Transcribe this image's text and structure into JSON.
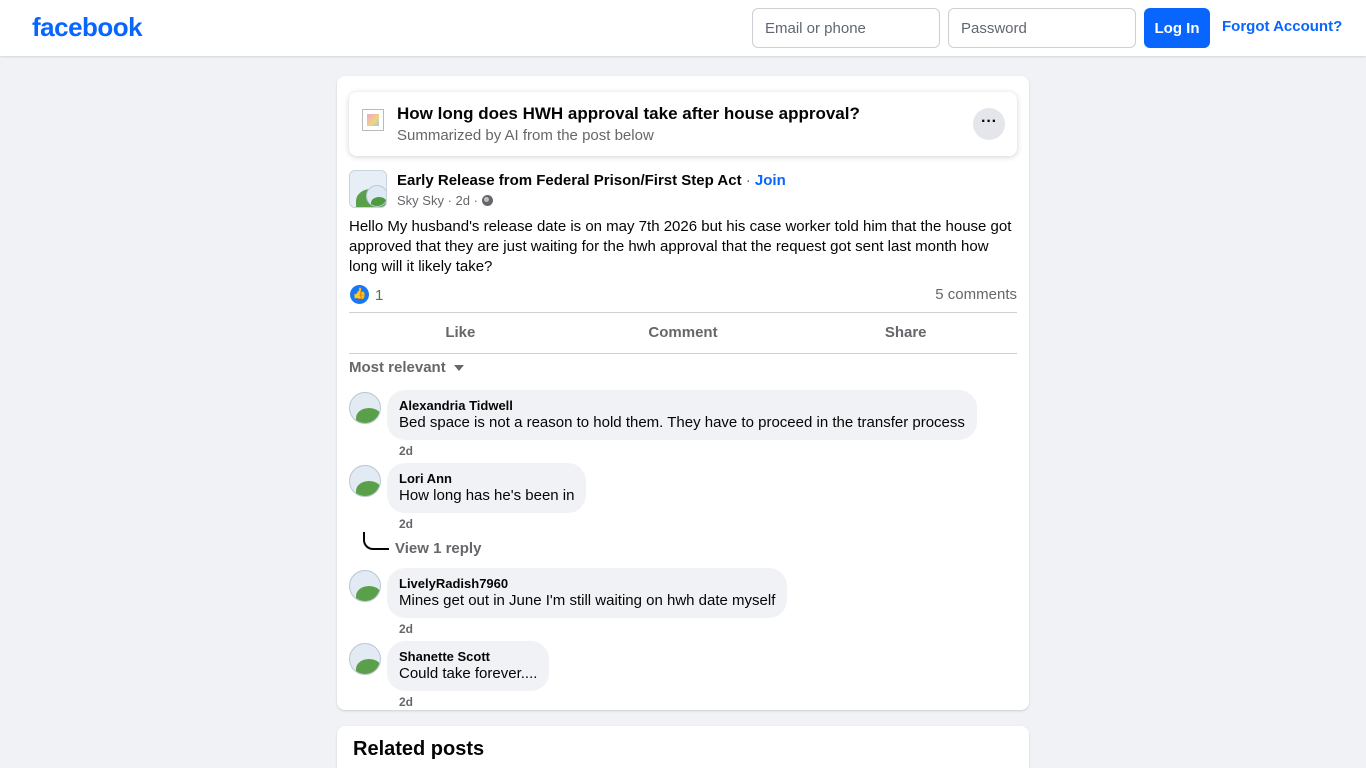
{
  "header": {
    "logo": "facebook",
    "email_placeholder": "Email or phone",
    "password_placeholder": "Password",
    "login_label": "Log In",
    "forgot_label": "Forgot Account?"
  },
  "summary": {
    "title": "How long does HWH approval take after house approval?",
    "subtitle": "Summarized by AI from the post below",
    "more_label": "···"
  },
  "post": {
    "group": "Early Release from Federal Prison/First Step Act",
    "separator": " · ",
    "join_label": "Join",
    "author": "Sky Sky",
    "time": "2d",
    "meta_sep": " · ",
    "body": "Hello My husband's release date is on may 7th 2026 but his case worker told him that the house got approved that they are just waiting for the hwh approval that the request got sent last month how long will it likely take?",
    "like_count": "1",
    "comments_count": "5 comments",
    "actions": {
      "like": "Like",
      "comment": "Comment",
      "share": "Share"
    }
  },
  "comments_section": {
    "sort_label": "Most relevant",
    "view_reply_label": "View 1 reply",
    "comments": [
      {
        "name": "Alexandria Tidwell",
        "text": "Bed space is not a reason to hold them. They have to proceed in the transfer process",
        "time": "2d"
      },
      {
        "name": "Lori Ann",
        "text": "How long has he's been in",
        "time": "2d"
      },
      {
        "name": "LivelyRadish7960",
        "text": "Mines get out in June I'm still waiting on hwh date myself",
        "time": "2d"
      },
      {
        "name": "Shanette Scott",
        "text": "Could take forever....",
        "time": "2d"
      }
    ]
  },
  "related": {
    "title": "Related posts"
  },
  "colors": {
    "brand": "#0866ff",
    "like_blue": "#1877f2",
    "secondary_text": "#65676b"
  },
  "icons": [
    "globe-icon",
    "like-icon",
    "caret-down-icon",
    "more-icon"
  ]
}
